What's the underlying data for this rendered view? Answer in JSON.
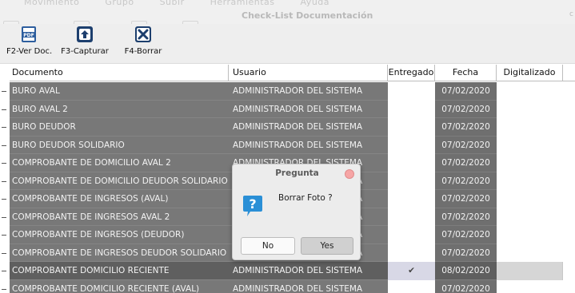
{
  "window": {
    "title": "Check-List Documentación",
    "close_mark": "c"
  },
  "background_menu": [
    "Movimiento",
    "Grupo",
    "Subir",
    "Herramientas",
    "Ayuda"
  ],
  "toolbar": {
    "buttons": [
      {
        "label": "F2-Ver Doc.",
        "icon": "pdf-icon"
      },
      {
        "label": "F3-Capturar",
        "icon": "capture-icon"
      },
      {
        "label": "F4-Borrar",
        "icon": "delete-icon"
      }
    ]
  },
  "grid": {
    "columns": [
      "Documento",
      "Usuario",
      "Entregado",
      "Fecha",
      "Digitalizado"
    ],
    "rows": [
      {
        "documento": "BURO AVAL",
        "usuario": "ADMINISTRADOR DEL SISTEMA",
        "entregado": "",
        "fecha": "07/02/2020",
        "digitalizado": ""
      },
      {
        "documento": "BURO AVAL 2",
        "usuario": "ADMINISTRADOR DEL SISTEMA",
        "entregado": "",
        "fecha": "07/02/2020",
        "digitalizado": ""
      },
      {
        "documento": "BURO DEUDOR",
        "usuario": "ADMINISTRADOR DEL SISTEMA",
        "entregado": "",
        "fecha": "07/02/2020",
        "digitalizado": ""
      },
      {
        "documento": "BURO DEUDOR SOLIDARIO",
        "usuario": "ADMINISTRADOR DEL SISTEMA",
        "entregado": "",
        "fecha": "07/02/2020",
        "digitalizado": ""
      },
      {
        "documento": "COMPROBANTE DE DOMICILIO AVAL 2",
        "usuario": "ADMINISTRADOR DEL SISTEMA",
        "entregado": "",
        "fecha": "07/02/2020",
        "digitalizado": ""
      },
      {
        "documento": "COMPROBANTE DE DOMICILIO DEUDOR SOLIDARIO",
        "usuario": "ADMINISTRADOR DEL SISTEMA",
        "entregado": "",
        "fecha": "07/02/2020",
        "digitalizado": ""
      },
      {
        "documento": "COMPROBANTE DE INGRESOS (AVAL)",
        "usuario": "ADMINISTRADOR DEL SISTEMA",
        "entregado": "",
        "fecha": "07/02/2020",
        "digitalizado": ""
      },
      {
        "documento": "COMPROBANTE DE INGRESOS AVAL 2",
        "usuario": "ADMINISTRADOR DEL SISTEMA",
        "entregado": "",
        "fecha": "07/02/2020",
        "digitalizado": ""
      },
      {
        "documento": "COMPROBANTE DE INGRESOS (DEUDOR)",
        "usuario": "ADMINISTRADOR DEL SISTEMA",
        "entregado": "",
        "fecha": "07/02/2020",
        "digitalizado": ""
      },
      {
        "documento": "COMPROBANTE DE INGRESOS DEUDOR SOLIDARIO",
        "usuario": "ADMINISTRADOR DEL SISTEMA",
        "entregado": "",
        "fecha": "07/02/2020",
        "digitalizado": ""
      },
      {
        "documento": "COMPROBANTE DOMICILIO RECIENTE",
        "usuario": "ADMINISTRADOR DEL SISTEMA",
        "entregado": "✔",
        "fecha": "08/02/2020",
        "digitalizado": "",
        "selected": true
      },
      {
        "documento": "COMPROBANTE DOMICILIO RECIENTE  (AVAL)",
        "usuario": "ADMINISTRADOR DEL SISTEMA",
        "entregado": "",
        "fecha": "07/02/2020",
        "digitalizado": ""
      }
    ]
  },
  "dialog": {
    "title": "Pregunta",
    "message": "Borrar Foto ?",
    "icon": "question-icon",
    "no_label": "No",
    "yes_label": "Yes"
  },
  "colors": {
    "grid_dark": "#787878",
    "date_dark": "#6f6f6f",
    "question_blue": "#2a8fd6",
    "close_pink": "#f6a5a5"
  }
}
